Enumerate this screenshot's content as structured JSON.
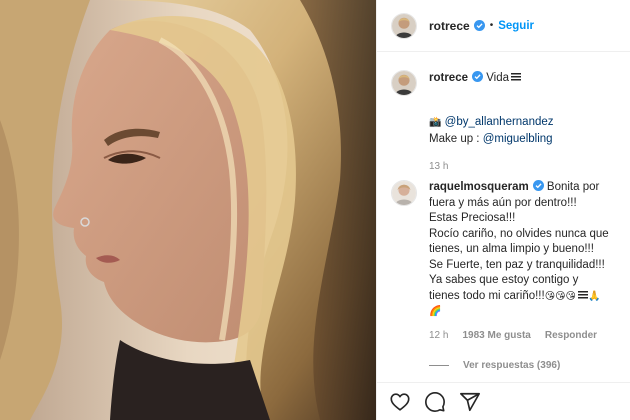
{
  "post": {
    "username": "rotrece",
    "follow_label": "Seguir",
    "separator": "•"
  },
  "caption": {
    "username": "rotrece",
    "title": "Vida",
    "photo_credit_prefix": "📸",
    "photo_credit": "@by_allanhernandez",
    "makeup_prefix": "Make up : ",
    "makeup_handle": "@miguelbling",
    "time": "13 h"
  },
  "comment": {
    "username": "raquelmosqueram",
    "first_line": "Bonita por",
    "lines": [
      "fuera y más aún por dentro!!!",
      "Estas Preciosa!!!",
      "Rocío cariño, no olvides nunca que",
      "tienes, un alma limpio y bueno!!!",
      "Se Fuerte, ten paz y tranquilidad!!!",
      "Ya sabes que estoy contigo y",
      "tienes todo mi cariño!!!"
    ],
    "emoji_tail": "😘😘😘",
    "emoji_last": "🙏",
    "emoji_rainbow": "🌈",
    "time": "12 h",
    "likes": "1983 Me gusta",
    "reply_label": "Responder",
    "view_replies": "Ver respuestas (396)"
  },
  "icons": {
    "like": "heart-icon",
    "comment": "comment-icon",
    "share": "share-icon",
    "verified": "verified-badge-icon"
  },
  "colors": {
    "accent": "#0095f6",
    "verified": "#3897f0",
    "muted": "#8e8e8e"
  }
}
